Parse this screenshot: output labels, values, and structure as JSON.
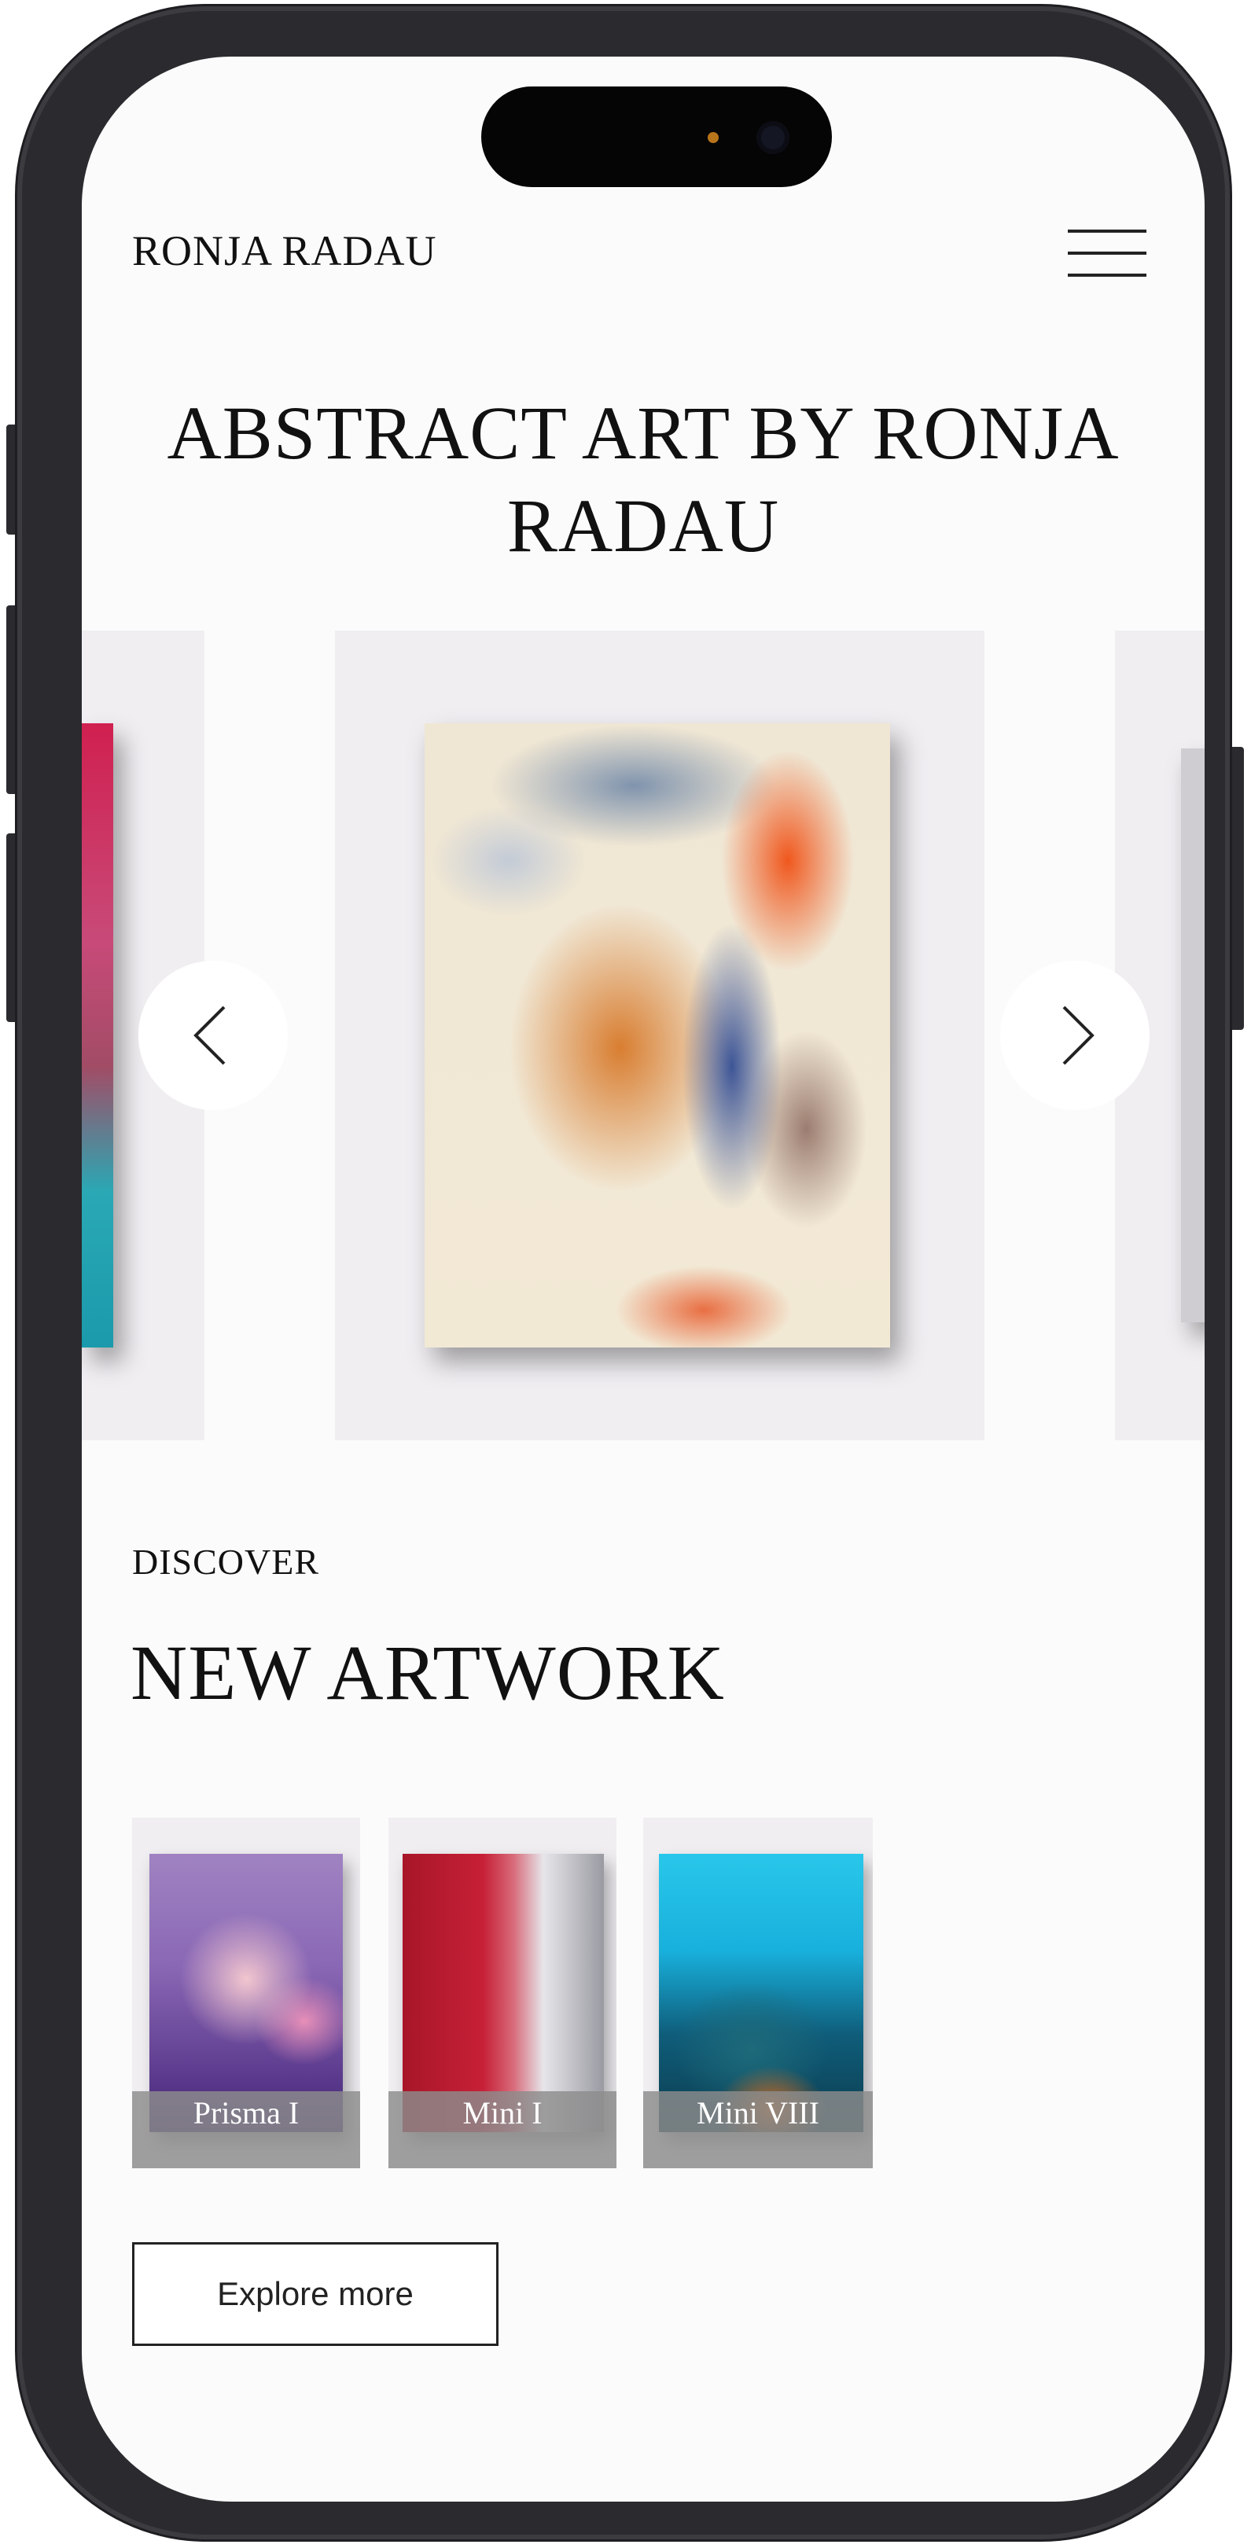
{
  "header": {
    "brand": "RONJA RADAU",
    "menu_icon": "hamburger-menu-icon"
  },
  "hero": {
    "title": "ABSTRACT ART BY RONJA RADAU"
  },
  "carousel": {
    "prev_icon": "chevron-left-icon",
    "next_icon": "chevron-right-icon"
  },
  "discover": {
    "eyebrow": "DISCOVER",
    "title": "NEW ARTWORK",
    "items": [
      {
        "caption": "Prisma I"
      },
      {
        "caption": "Mini I"
      },
      {
        "caption": "Mini VIII"
      }
    ],
    "explore_label": "Explore more"
  }
}
